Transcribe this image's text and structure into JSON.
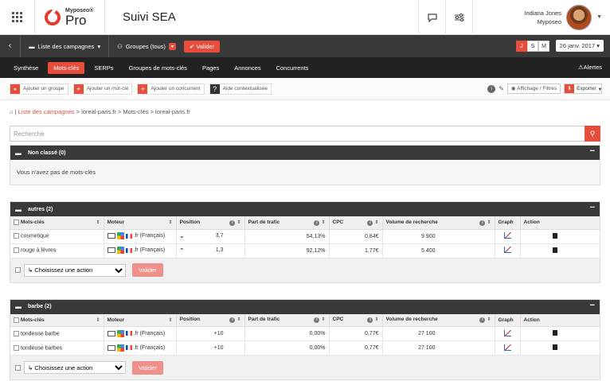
{
  "header": {
    "brand_small": "Myposeo®",
    "brand_pro": "Pro",
    "app_title": "Suivi SEA",
    "user_name": "Indiana Jones",
    "user_company": "Myposeo"
  },
  "bar2": {
    "campaigns_label": "Liste des campagnes",
    "groups_label": "Groupes (tous)",
    "validate_label": "Valider",
    "period": [
      "J",
      "S",
      "M"
    ],
    "date": "26 janv. 2017"
  },
  "tabs": [
    {
      "label": "Synthèse",
      "active": false
    },
    {
      "label": "Mots-clés",
      "active": true
    },
    {
      "label": "SERPs",
      "active": false
    },
    {
      "label": "Groupes de mots-clés",
      "active": false
    },
    {
      "label": "Pages",
      "active": false
    },
    {
      "label": "Annonces",
      "active": false
    },
    {
      "label": "Concurrents",
      "active": false
    }
  ],
  "alerts_label": "Alertes",
  "toolbar": {
    "add_group": "Ajouter un groupe",
    "add_keyword": "Ajouter un mot-clé",
    "add_competitor": "Ajouter un concurrent",
    "help": "Aide contextualisée",
    "display_filters": "Affichage / Filtres",
    "export": "Exporter"
  },
  "breadcrumb": {
    "link": "Liste des campagnes",
    "rest": " > loreal-paris.fr > Mots-clés > loreal-paris.fr"
  },
  "search": {
    "placeholder": "Recherche"
  },
  "columns": [
    "Mots-clés",
    "Moteur",
    "Position",
    "Part de trafic",
    "CPC",
    "Volume de recherche",
    "Graph",
    "Action"
  ],
  "groups": [
    {
      "title": "Non classé (0)",
      "empty_text": "Vous n'avez pas de mots-clés",
      "rows": []
    },
    {
      "title": "autres (2)",
      "rows": [
        {
          "keyword": "cosmetique",
          "engine": ".fr (Français)",
          "trend": "down",
          "position": "3,7",
          "traffic": "54,13%",
          "cpc": "0,84€",
          "volume": "9 900"
        },
        {
          "keyword": "rouge à lèvres",
          "engine": ".fr (Français)",
          "trend": "up",
          "position": "1,3",
          "traffic": "92,12%",
          "cpc": "1,77€",
          "volume": "5 400"
        }
      ]
    },
    {
      "title": "barbe (2)",
      "rows": [
        {
          "keyword": "tondeuse barbe",
          "engine": ".fr (Français)",
          "trend": "",
          "position": "+10",
          "traffic": "0,00%",
          "cpc": "0,77€",
          "volume": "27 100"
        },
        {
          "keyword": "tondeuse barbes",
          "engine": ".fr (Français)",
          "trend": "",
          "position": "+10",
          "traffic": "0,00%",
          "cpc": "0,77€",
          "volume": "27 100"
        }
      ]
    }
  ],
  "action_select": "↳ Choisissez une action",
  "action_validate": "Valider"
}
